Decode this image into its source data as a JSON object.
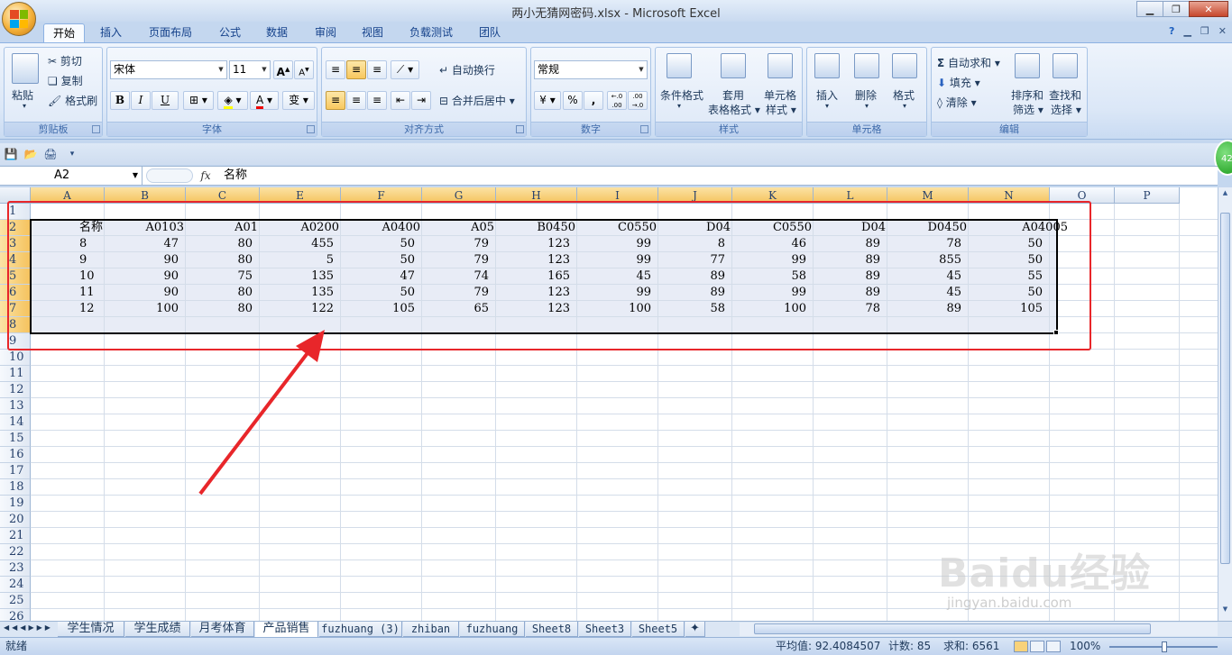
{
  "window": {
    "title": "两小无猜网密码.xlsx - Microsoft Excel"
  },
  "ribbon_tabs": [
    "开始",
    "插入",
    "页面布局",
    "公式",
    "数据",
    "审阅",
    "视图",
    "负载测试",
    "团队"
  ],
  "clipboard": {
    "paste": "粘贴",
    "cut": "剪切",
    "copy": "复制",
    "format_painter": "格式刷",
    "label": "剪贴板"
  },
  "font": {
    "name": "宋体",
    "size": "11",
    "bold": "B",
    "italic": "I",
    "underline": "U",
    "label": "字体",
    "grow": "A",
    "shrink": "A",
    "color": "A",
    "phonetic": "变"
  },
  "alignment": {
    "wrap": "自动换行",
    "merge": "合并后居中",
    "label": "对齐方式"
  },
  "number": {
    "format": "常规",
    "currency": "¥",
    "percent": "%",
    "comma": ",",
    "inc": "←.0 .00",
    "dec": ".00 →.0",
    "label": "数字"
  },
  "styles": {
    "conditional_1": "条件格式",
    "table_1": "套用",
    "table_2": "表格格式",
    "cell_1": "单元格",
    "cell_2": "样式",
    "label": "样式"
  },
  "cells": {
    "insert": "插入",
    "delete": "删除",
    "format": "格式",
    "label": "单元格"
  },
  "editing": {
    "autosum": "自动求和",
    "fill": "填充",
    "clear": "清除",
    "sort_1": "排序和",
    "sort_2": "筛选",
    "find_1": "查找和",
    "find_2": "选择",
    "label": "编辑",
    "sigma": "Σ"
  },
  "formula_bar": {
    "name_box": "A2",
    "fx": "fx",
    "value": "名称"
  },
  "badge": "42",
  "columns": [
    "A",
    "B",
    "C",
    "E",
    "F",
    "G",
    "H",
    "I",
    "J",
    "K",
    "L",
    "M",
    "N",
    "O",
    "P"
  ],
  "rows": [
    "1",
    "2",
    "3",
    "4",
    "5",
    "6",
    "7",
    "8",
    "9",
    "10",
    "11",
    "12",
    "13",
    "14",
    "15",
    "16",
    "17",
    "18",
    "19",
    "20",
    "21",
    "22",
    "23",
    "24",
    "25",
    "26"
  ],
  "table": {
    "header": [
      "名称",
      "A0103",
      "A01",
      "A0200",
      "A0400",
      "A05",
      "B0450",
      "C0550",
      "D04",
      "C0550",
      "D04",
      "D0450",
      "A04005"
    ],
    "data": [
      [
        "8",
        "47",
        "80",
        "455",
        "50",
        "79",
        "123",
        "99",
        "8",
        "46",
        "89",
        "78",
        "50"
      ],
      [
        "9",
        "90",
        "80",
        "5",
        "50",
        "79",
        "123",
        "99",
        "77",
        "99",
        "89",
        "855",
        "50"
      ],
      [
        "10",
        "90",
        "75",
        "135",
        "47",
        "74",
        "165",
        "45",
        "89",
        "58",
        "89",
        "45",
        "55"
      ],
      [
        "11",
        "90",
        "80",
        "135",
        "50",
        "79",
        "123",
        "99",
        "89",
        "99",
        "89",
        "45",
        "50"
      ],
      [
        "12",
        "100",
        "80",
        "122",
        "105",
        "65",
        "123",
        "100",
        "58",
        "100",
        "78",
        "89",
        "105"
      ]
    ]
  },
  "sheet_tabs": [
    "学生情况",
    "学生成绩",
    "月考体育",
    "产品销售",
    "fuzhuang (3)",
    "zhiban",
    "fuzhuang",
    "Sheet8",
    "Sheet3",
    "Sheet5"
  ],
  "active_sheet": "产品销售",
  "status": {
    "ready": "就绪",
    "average": "平均值: 92.4084507",
    "count": "计数: 85",
    "sum": "求和: 6561",
    "zoom": "100%"
  },
  "colors": {
    "accent": "#e8262a",
    "selection_header": "#f5c35e"
  },
  "watermark": {
    "brand": "Baidu经验",
    "url": "jingyan.baidu.com"
  }
}
